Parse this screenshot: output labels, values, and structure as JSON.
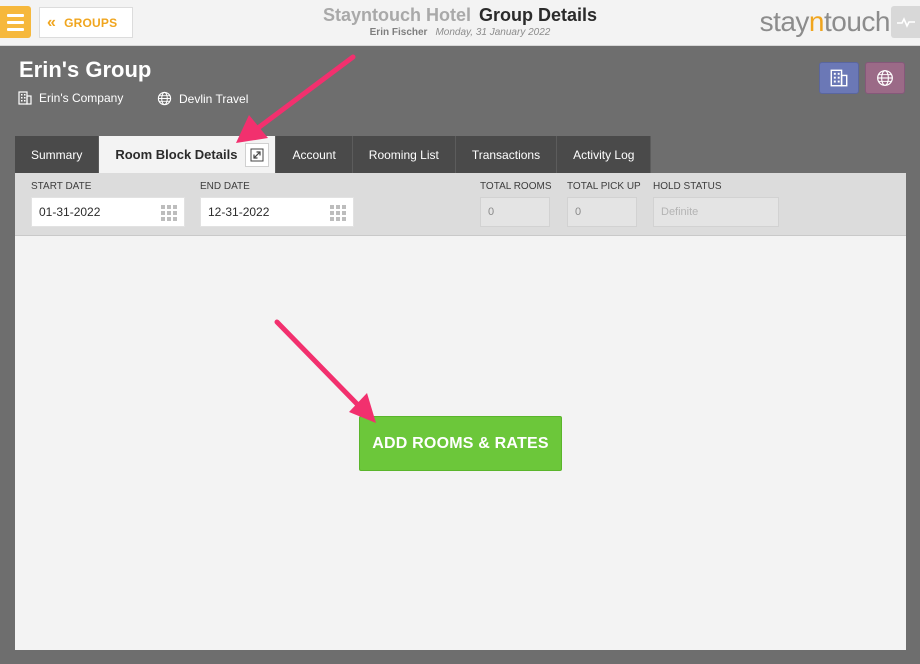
{
  "header": {
    "groups_label": "GROUPS",
    "hotel_name": "Stayntouch Hotel",
    "page_title": "Group Details",
    "user_name": "Erin Fischer",
    "date": "Monday, 31 January 2022",
    "logo_pre": "stay",
    "logo_accent": "n",
    "logo_post": "touch"
  },
  "group": {
    "name": "Erin's Group",
    "company": "Erin's Company",
    "travel_agent": "Devlin Travel"
  },
  "tabs": [
    {
      "label": "Summary"
    },
    {
      "label": "Room Block Details",
      "active": true
    },
    {
      "label": "Account"
    },
    {
      "label": "Rooming List"
    },
    {
      "label": "Transactions"
    },
    {
      "label": "Activity Log"
    }
  ],
  "room_block": {
    "start_date_label": "START DATE",
    "start_date_value": "01-31-2022",
    "end_date_label": "END DATE",
    "end_date_value": "12-31-2022",
    "total_rooms_label": "TOTAL ROOMS",
    "total_rooms_value": "0",
    "total_pickup_label": "TOTAL PICK UP",
    "total_pickup_value": "0",
    "hold_status_label": "HOLD STATUS",
    "hold_status_placeholder": "Definite",
    "add_button_label": "ADD ROOMS & RATES"
  },
  "colors": {
    "accent_orange": "#f0a51e",
    "add_button_green": "#6cc73a",
    "annotation_arrow": "#f2306e"
  }
}
